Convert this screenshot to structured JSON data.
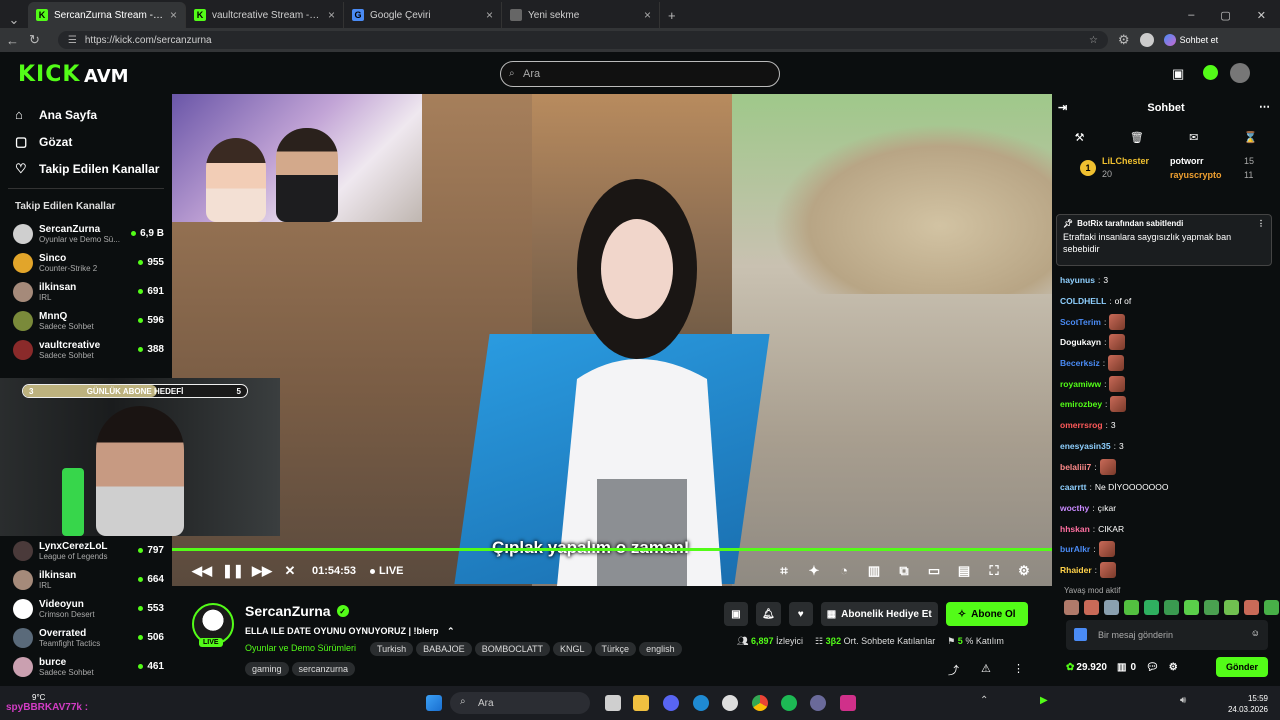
{
  "browser": {
    "tabs": [
      {
        "title": "SercanZurna Stream - Watch Live o",
        "fav": "K",
        "favColor": "#53fc18",
        "active": true
      },
      {
        "title": "vaultcreative Stream - Watch Live o",
        "fav": "K",
        "favColor": "#53fc18",
        "active": false
      },
      {
        "title": "Google Çeviri",
        "fav": "G",
        "favColor": "#4a8bf5",
        "active": false
      },
      {
        "title": "Yeni sekme",
        "fav": "",
        "favColor": "#666666",
        "active": false
      }
    ],
    "url": "https://kick.com/sercanzurna",
    "profile_btn": "Sohbet et"
  },
  "header": {
    "logo": "KICK",
    "logo_suffix": "AVM",
    "search_placeholder": "Ara"
  },
  "sidebar": {
    "nav": [
      {
        "label": "Ana Sayfa",
        "icon": "home-icon"
      },
      {
        "label": "Gözat",
        "icon": "browse-icon"
      },
      {
        "label": "Takip Edilen Kanallar",
        "icon": "heart-icon"
      }
    ],
    "followed_heading": "Takip Edilen Kanallar",
    "channels_top": [
      {
        "name": "SercanZurna",
        "category": "Oyunlar ve Demo Sü...",
        "viewers": "6,9 B",
        "color": "#cfcfcf"
      },
      {
        "name": "Sinco",
        "category": "Counter-Strike 2",
        "viewers": "955",
        "color": "#e2a52a"
      },
      {
        "name": "ilkinsan",
        "category": "IRL",
        "viewers": "691",
        "color": "#a58a7a"
      },
      {
        "name": "MnnQ",
        "category": "Sadece Sohbet",
        "viewers": "596",
        "color": "#7a8a3a"
      },
      {
        "name": "vaultcreative",
        "category": "Sadece Sohbet",
        "viewers": "388",
        "color": "#8a2a2a"
      }
    ],
    "channels_bottom": [
      {
        "name": "LynxCerezLoL",
        "category": "League of Legends",
        "viewers": "797",
        "color": "#4a3a3a"
      },
      {
        "name": "ilkinsan",
        "category": "IRL",
        "viewers": "664",
        "color": "#a58a7a"
      },
      {
        "name": "Videoyun",
        "category": "Crimson Desert",
        "viewers": "553",
        "color": "#ffffff"
      },
      {
        "name": "Overrated",
        "category": "Teamfight Tactics",
        "viewers": "506",
        "color": "#5a6a7a"
      },
      {
        "name": "burce",
        "category": "Sadece Sohbet",
        "viewers": "461",
        "color": "#caa0b0"
      }
    ]
  },
  "player": {
    "goal_label": "GÜNLÜK ABONE HEDEFİ",
    "goal_left": "3",
    "goal_right": "5",
    "goal_fraction": 0.6,
    "subtitle": "Çıplak yapalım o zaman!",
    "time": "01:54:53",
    "live": "LIVE"
  },
  "stream": {
    "name": "SercanZurna",
    "live_badge": "LIVE",
    "title": "ELLA ILE DATE OYUNU OYNUYORUZ | !blerp",
    "category": "Oyunlar ve Demo Sürümleri",
    "tags1": [
      "Turkish",
      "BABAJOE",
      "BOMBOCLATT",
      "KNGL",
      "Türkçe",
      "english"
    ],
    "tags2": [
      "gaming",
      "sercanzurna"
    ],
    "gift_btn": "Abonelik Hediye Et",
    "sub_btn": "Abone Ol",
    "viewers_num": "6,897",
    "viewers_label": "İzleyici",
    "chatters_num": "3β2",
    "chatters_label": "Ort. Sohbete Katılanlar",
    "pct_num": "5",
    "pct_label": "% Katılım"
  },
  "chat": {
    "title": "Sohbet",
    "leader1_name": "LiLChester",
    "leader1_count": "20",
    "leader2_name": "potworr",
    "leader2_count": "15",
    "leader3_name": "rayuscrypto",
    "leader3_count": "11",
    "pinned_by": "BotRix tarafından sabitlendi",
    "pinned_text": "Etraftaki insanlara saygısızlık yapmak ban sebebidir",
    "messages": [
      {
        "user": "hayunus",
        "text": "3",
        "color": "#8fd0ff",
        "emote": false
      },
      {
        "user": "COLDHELL",
        "text": "of of",
        "color": "#8fd0ff",
        "emote": false
      },
      {
        "user": "ScotTerim",
        "text": "",
        "color": "#4a8bf5",
        "emote": true
      },
      {
        "user": "Dogukayn",
        "text": "",
        "color": "#ffffff",
        "emote": true
      },
      {
        "user": "Becerksiz",
        "text": "",
        "color": "#4a8bf5",
        "emote": true
      },
      {
        "user": "royamiww",
        "text": "",
        "color": "#53fc18",
        "emote": true
      },
      {
        "user": "emirozbey",
        "text": "",
        "color": "#53fc18",
        "emote": true
      },
      {
        "user": "omerrsrog",
        "text": "3",
        "color": "#ff5a5a",
        "emote": false
      },
      {
        "user": "enesyasin35",
        "text": "3",
        "color": "#8fd0ff",
        "emote": false
      },
      {
        "user": "belaliii7",
        "text": "",
        "color": "#ff8a8a",
        "emote": true
      },
      {
        "user": "caarrtt",
        "text": "Ne DİYOOOOOOO",
        "color": "#8fd0ff",
        "emote": false
      },
      {
        "user": "wocthy",
        "text": "çıkar",
        "color": "#c98aff",
        "emote": false
      },
      {
        "user": "hhskan",
        "text": "CIKAR",
        "color": "#ff6fa0",
        "emote": false
      },
      {
        "user": "burAlkr",
        "text": "",
        "color": "#4a8bf5",
        "emote": true
      },
      {
        "user": "Rhaider",
        "text": "",
        "color": "#ffd24a",
        "emote": true
      }
    ],
    "slow_mode": "Yavaş mod aktif",
    "input_placeholder": "Bir mesaj gönderin",
    "points": "29.920",
    "gifts": "0",
    "send_btn": "Gönder"
  },
  "taskbar": {
    "weather": "9°C",
    "search": "Ara",
    "time": "15:59",
    "date": "24.03.2026"
  },
  "overlay_name": "spyBBRKAV77k :"
}
